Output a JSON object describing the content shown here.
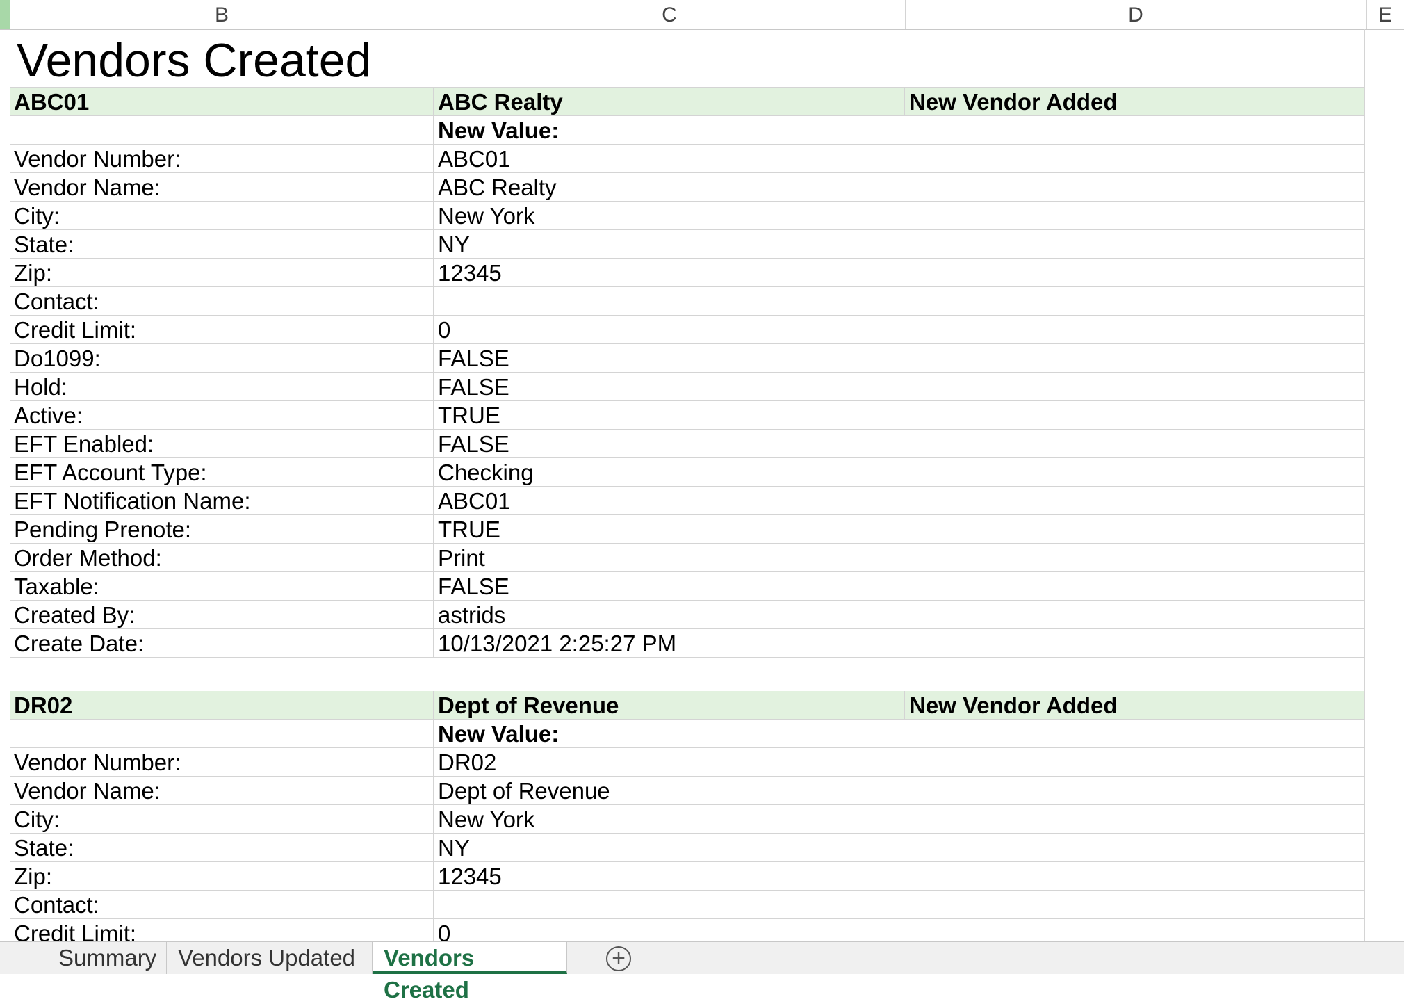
{
  "columns": [
    "B",
    "C",
    "D",
    "E"
  ],
  "title": "Vendors Created",
  "field_labels": [
    "Vendor Number:",
    "Vendor Name:",
    "City:",
    "State:",
    "Zip:",
    "Contact:",
    "Credit Limit:",
    "Do1099:",
    "Hold:",
    "Active:",
    "EFT Enabled:",
    "EFT Account Type:",
    "EFT Notification Name:",
    "Pending Prenote:",
    "Order Method:",
    "Taxable:",
    "Created By:",
    "Create Date:"
  ],
  "new_value_label": "New Value:",
  "status_label": "New Vendor Added",
  "vendors": [
    {
      "code": "ABC01",
      "name": "ABC Realty",
      "values": [
        "ABC01",
        "ABC Realty",
        "New York",
        "NY",
        "12345",
        "",
        "0",
        "FALSE",
        "FALSE",
        "TRUE",
        "FALSE",
        "Checking",
        "ABC01",
        "TRUE",
        "Print",
        "FALSE",
        "astrids",
        "10/13/2021 2:25:27 PM"
      ]
    },
    {
      "code": "DR02",
      "name": "Dept of Revenue",
      "values": [
        "DR02",
        "Dept of Revenue",
        "New York",
        "NY",
        "12345",
        "",
        "0"
      ]
    }
  ],
  "sheet_tabs": [
    {
      "label": "Summary",
      "active": false
    },
    {
      "label": "Vendors Updated",
      "active": false
    },
    {
      "label": "Vendors Created",
      "active": true
    }
  ],
  "colors": {
    "header_fill": "#e2f2df",
    "active_tab": "#1e7145"
  }
}
